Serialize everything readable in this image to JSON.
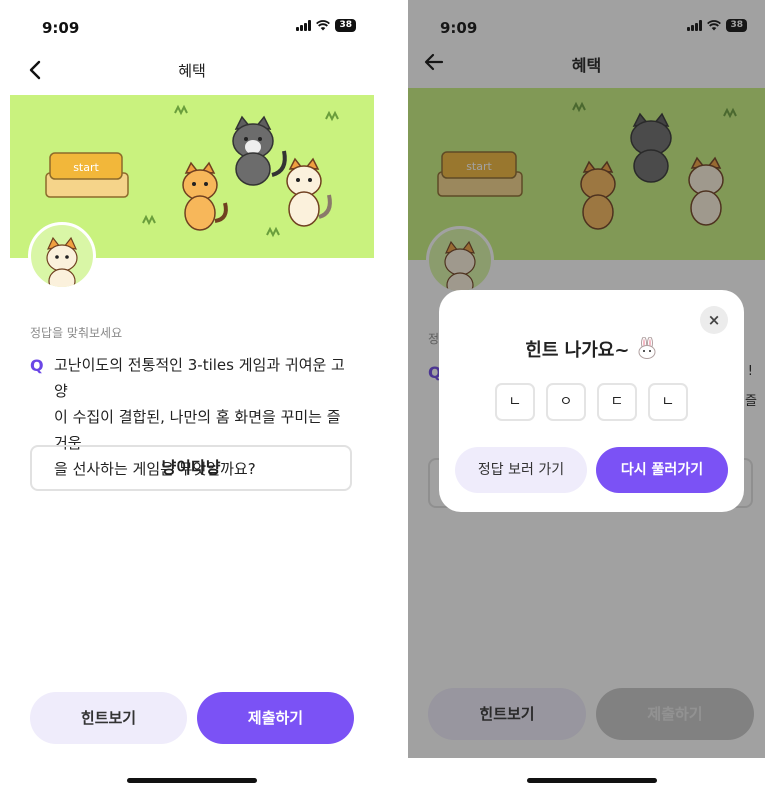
{
  "status_bar": {
    "time": "9:09",
    "battery": "38"
  },
  "nav": {
    "title": "혜택"
  },
  "banner": {
    "start_label": "start",
    "colors": {
      "background": "#c9f27e",
      "accent": "#7b52f5"
    }
  },
  "quiz": {
    "prompt": "정답을 맞춰보세요",
    "q_mark": "Q",
    "question_lines": [
      "고난이도의 전통적인 3-tiles 게임과 귀여운 고양",
      "이 수집이 결합된, 나만의 홈 화면을 꾸미는 즐거움",
      "을 선사하는 게임은 무엇일까요?"
    ],
    "answer": "냥이다냥"
  },
  "buttons": {
    "hint": "힌트보기",
    "submit": "제출하기"
  },
  "hint_modal": {
    "title": "힌트 나가요~",
    "close": "×",
    "letters": [
      "ㄴ",
      "ㅇ",
      "ㄷ",
      "ㄴ"
    ],
    "secondary": "정답 보러 가기",
    "primary": "다시 풀러가기"
  },
  "background_peek": {
    "q_mark": "Q",
    "prompt_char": "정",
    "right_chars": [
      "!",
      "즐"
    ]
  }
}
